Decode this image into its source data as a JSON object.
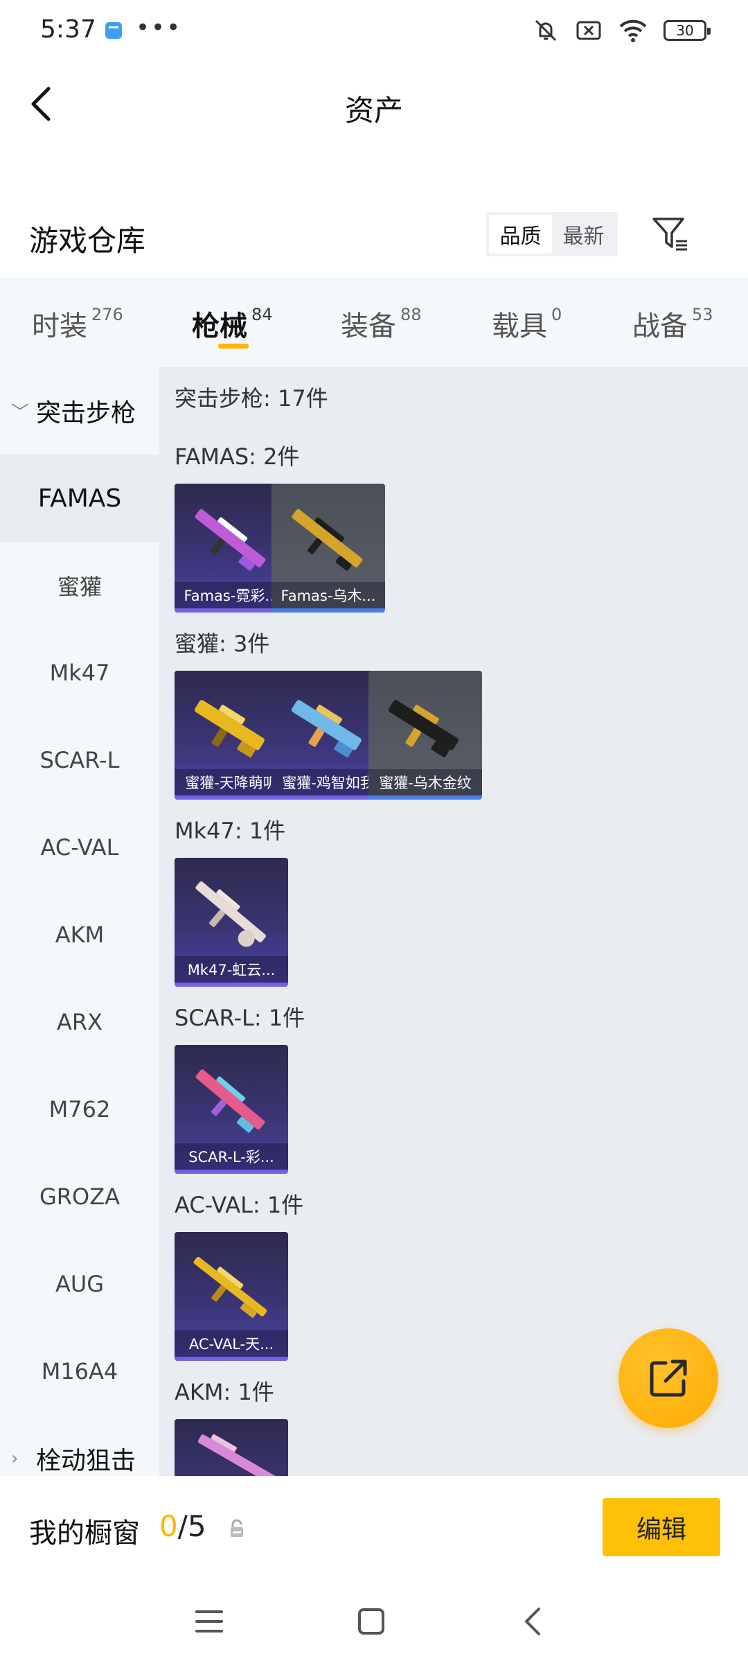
{
  "status_bar": {
    "time": "5:37",
    "dots": "•••",
    "battery": "30"
  },
  "header": {
    "title": "资产"
  },
  "warehouse": {
    "title": "游戏仓库",
    "sort_options": [
      "品质",
      "最新"
    ],
    "sort_active": "品质"
  },
  "tabs": [
    {
      "label": "时装",
      "count": "276"
    },
    {
      "label": "枪械",
      "count": "84",
      "active": true
    },
    {
      "label": "装备",
      "count": "88"
    },
    {
      "label": "载具",
      "count": "0"
    },
    {
      "label": "战备",
      "count": "53"
    }
  ],
  "sidebar": {
    "group_open": "突击步枪",
    "items": [
      "FAMAS",
      "蜜獾",
      "Mk47",
      "SCAR-L",
      "AC-VAL",
      "AKM",
      "ARX",
      "M762",
      "GROZA",
      "AUG",
      "M16A4"
    ],
    "active_item": "FAMAS",
    "group_closed": "栓动狙击"
  },
  "main": {
    "group_head": "突击步枪: 17件",
    "sections": [
      {
        "head": "FAMAS: 2件",
        "cards": [
          {
            "name": "Famas-霓彩...",
            "style": "purple",
            "gun_color": "#c05bd8"
          },
          {
            "name": "Famas-乌木...",
            "style": "gray",
            "gun_color": "#d4a52a"
          }
        ]
      },
      {
        "head": "蜜獾: 3件",
        "cards": [
          {
            "name": "蜜獾-天降萌叽",
            "style": "purple",
            "gun_color": "#e8b820"
          },
          {
            "name": "蜜獾-鸡智如我",
            "style": "purple",
            "gun_color": "#6fb8e8"
          },
          {
            "name": "蜜獾-乌木金纹",
            "style": "gray",
            "gun_color": "#d4a52a"
          }
        ]
      },
      {
        "head": "Mk47: 1件",
        "cards": [
          {
            "name": "Mk47-虹云...",
            "style": "purple",
            "gun_color": "#e8dcd6"
          }
        ]
      },
      {
        "head": "SCAR-L: 1件",
        "cards": [
          {
            "name": "SCAR-L-彩...",
            "style": "purple",
            "gun_color": "#e85a8a"
          }
        ]
      },
      {
        "head": "AC-VAL: 1件",
        "cards": [
          {
            "name": "AC-VAL-天...",
            "style": "purple",
            "gun_color": "#e8b820"
          }
        ]
      },
      {
        "head": "AKM: 1件",
        "cards": [
          {
            "name": "",
            "style": "purple",
            "gun_color": "#d88ad8"
          }
        ]
      }
    ]
  },
  "showcase": {
    "label": "我的橱窗",
    "current": "0",
    "total": "/5",
    "edit_label": "编辑"
  },
  "colors": {
    "accent": "#ffb400",
    "edit_button": "#ffc107"
  }
}
